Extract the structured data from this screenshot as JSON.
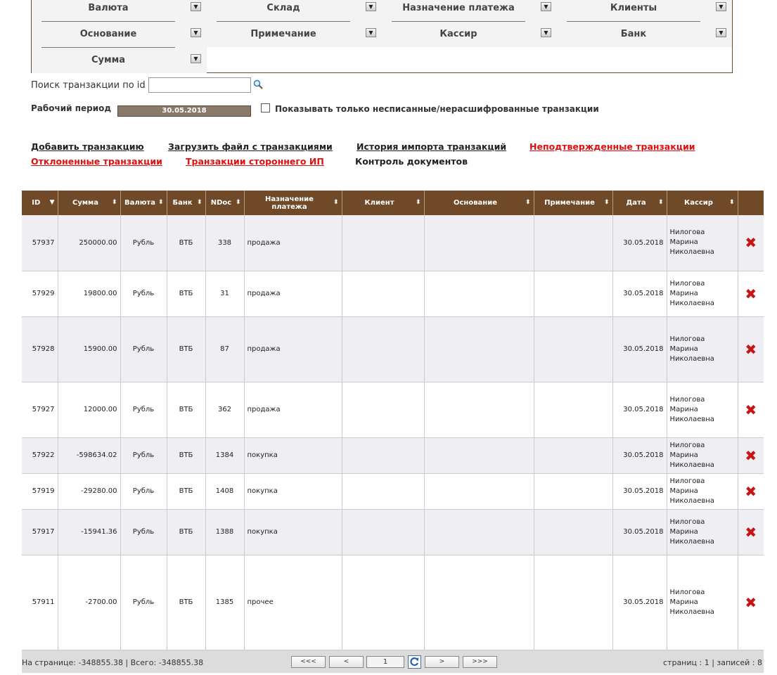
{
  "filters": [
    {
      "label": "Валюта"
    },
    {
      "label": "Склад"
    },
    {
      "label": "Назначение платежа"
    },
    {
      "label": "Клиенты"
    },
    {
      "label": "Основание"
    },
    {
      "label": "Примечание"
    },
    {
      "label": "Кассир"
    },
    {
      "label": "Банк"
    },
    {
      "label": "Сумма"
    }
  ],
  "search": {
    "label": "Поиск транзакции по id",
    "value": ""
  },
  "period": {
    "label": "Рабочий период",
    "value": "30.05.2018"
  },
  "show_only": {
    "label": "Показывать только несписанные/нерасшифрованные транзакции",
    "checked": false
  },
  "links": {
    "add": "Добавить транзакцию",
    "upload": "Загрузить файл с транзакциями",
    "history": "История импорта транзакций",
    "unconfirmed": "Неподтвержденные транзакции",
    "rejected": "Отклоненные транзакции",
    "third_party": "Транзакции стороннего ИП",
    "docs_control": "Контроль документов"
  },
  "table": {
    "columns": {
      "id": "ID",
      "sum": "Сумма",
      "currency": "Валюта",
      "bank": "Банк",
      "ndoc": "NDoc",
      "purpose": "Назначение платежа",
      "client": "Клиент",
      "basis": "Основание",
      "note": "Примечание",
      "date": "Дата",
      "cashier": "Кассир"
    },
    "rows": [
      {
        "id": "57937",
        "sum": "250000.00",
        "currency": "Рубль",
        "bank": "ВТБ",
        "ndoc": "338",
        "purpose": "продажа",
        "client": "",
        "basis": "",
        "note": "",
        "date": "30.05.2018",
        "cashier": [
          "Нилогова",
          "Марина",
          "Николаевна"
        ]
      },
      {
        "id": "57929",
        "sum": "19800.00",
        "currency": "Рубль",
        "bank": "ВТБ",
        "ndoc": "31",
        "purpose": "продажа",
        "client": "",
        "basis": "",
        "note": "",
        "date": "30.05.2018",
        "cashier": [
          "Нилогова",
          "Марина",
          "Николаевна"
        ]
      },
      {
        "id": "57928",
        "sum": "15900.00",
        "currency": "Рубль",
        "bank": "ВТБ",
        "ndoc": "87",
        "purpose": "продажа",
        "client": "",
        "basis": "",
        "note": "",
        "date": "30.05.2018",
        "cashier": [
          "Нилогова",
          "Марина",
          "Николаевна"
        ]
      },
      {
        "id": "57927",
        "sum": "12000.00",
        "currency": "Рубль",
        "bank": "ВТБ",
        "ndoc": "362",
        "purpose": "продажа",
        "client": "",
        "basis": "",
        "note": "",
        "date": "30.05.2018",
        "cashier": [
          "Нилогова",
          "Марина",
          "Николаевна"
        ]
      },
      {
        "id": "57922",
        "sum": "-598634.02",
        "currency": "Рубль",
        "bank": "ВТБ",
        "ndoc": "1384",
        "purpose": "покупка",
        "client": "",
        "basis": "",
        "note": "",
        "date": "30.05.2018",
        "cashier": [
          "Нилогова",
          "Марина",
          "Николаевна"
        ]
      },
      {
        "id": "57919",
        "sum": "-29280.00",
        "currency": "Рубль",
        "bank": "ВТБ",
        "ndoc": "1408",
        "purpose": "покупка",
        "client": "",
        "basis": "",
        "note": "",
        "date": "30.05.2018",
        "cashier": [
          "Нилогова",
          "Марина",
          "Николаевна"
        ]
      },
      {
        "id": "57917",
        "sum": "-15941.36",
        "currency": "Рубль",
        "bank": "ВТБ",
        "ndoc": "1388",
        "purpose": "покупка",
        "client": "",
        "basis": "",
        "note": "",
        "date": "30.05.2018",
        "cashier": [
          "Нилогова",
          "Марина",
          "Николаевна"
        ]
      },
      {
        "id": "57911",
        "sum": "-2700.00",
        "currency": "Рубль",
        "bank": "ВТБ",
        "ndoc": "1385",
        "purpose": "прочее",
        "client": "",
        "basis": "",
        "note": "",
        "date": "30.05.2018",
        "cashier": [
          "Нилогова",
          "Марина",
          "Николаевна"
        ]
      }
    ]
  },
  "footer": {
    "page_total": "На странице: -348855.38 | Всего: -348855.38",
    "first": "<<<",
    "prev": "<",
    "page": "1",
    "next": ">",
    "last": ">>>",
    "summary": "страниц : 1 | записей : 8"
  },
  "colors": {
    "header_brown": "#704a28",
    "link_red": "#e01010",
    "delete_red": "#c81414",
    "row_alt": "#efeff3"
  },
  "icons": {
    "search": "magnifier-icon",
    "delete": "cross-icon",
    "refresh": "refresh-icon",
    "dropdown": "dropdown-arrow-icon"
  }
}
